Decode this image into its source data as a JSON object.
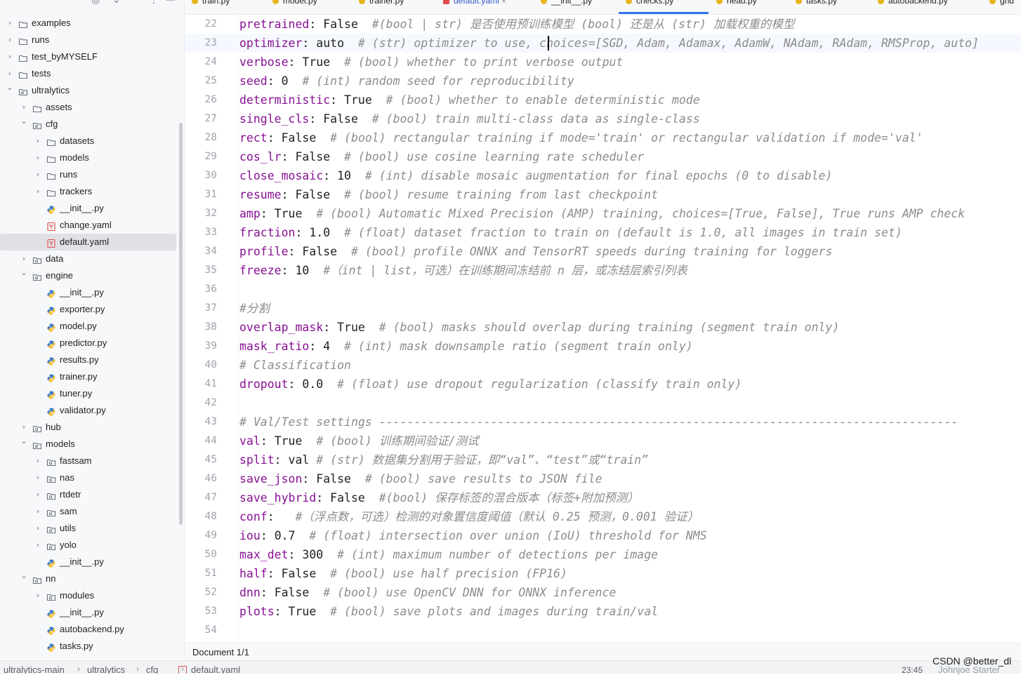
{
  "sidebar": {
    "items": [
      {
        "label": "examples",
        "type": "folder",
        "depth": 0,
        "open": false
      },
      {
        "label": "runs",
        "type": "folder",
        "depth": 0,
        "open": false
      },
      {
        "label": "test_byMYSELF",
        "type": "folder",
        "depth": 0,
        "open": false
      },
      {
        "label": "tests",
        "type": "folder",
        "depth": 0,
        "open": false
      },
      {
        "label": "ultralytics",
        "type": "package",
        "depth": 0,
        "open": true
      },
      {
        "label": "assets",
        "type": "folder",
        "depth": 1,
        "open": false
      },
      {
        "label": "cfg",
        "type": "package",
        "depth": 1,
        "open": true
      },
      {
        "label": "datasets",
        "type": "folder",
        "depth": 2,
        "open": false
      },
      {
        "label": "models",
        "type": "folder",
        "depth": 2,
        "open": false
      },
      {
        "label": "runs",
        "type": "folder",
        "depth": 2,
        "open": false
      },
      {
        "label": "trackers",
        "type": "folder",
        "depth": 2,
        "open": false
      },
      {
        "label": "__init__.py",
        "type": "python",
        "depth": 2
      },
      {
        "label": "change.yaml",
        "type": "yaml",
        "depth": 2
      },
      {
        "label": "default.yaml",
        "type": "yaml",
        "depth": 2,
        "selected": true
      },
      {
        "label": "data",
        "type": "package",
        "depth": 1,
        "open": false
      },
      {
        "label": "engine",
        "type": "package",
        "depth": 1,
        "open": true
      },
      {
        "label": "__init__.py",
        "type": "python",
        "depth": 2
      },
      {
        "label": "exporter.py",
        "type": "python",
        "depth": 2
      },
      {
        "label": "model.py",
        "type": "python",
        "depth": 2
      },
      {
        "label": "predictor.py",
        "type": "python",
        "depth": 2
      },
      {
        "label": "results.py",
        "type": "python",
        "depth": 2
      },
      {
        "label": "trainer.py",
        "type": "python",
        "depth": 2
      },
      {
        "label": "tuner.py",
        "type": "python",
        "depth": 2
      },
      {
        "label": "validator.py",
        "type": "python",
        "depth": 2
      },
      {
        "label": "hub",
        "type": "package",
        "depth": 1,
        "open": false
      },
      {
        "label": "models",
        "type": "package",
        "depth": 1,
        "open": true
      },
      {
        "label": "fastsam",
        "type": "package",
        "depth": 2,
        "open": false
      },
      {
        "label": "nas",
        "type": "package",
        "depth": 2,
        "open": false
      },
      {
        "label": "rtdetr",
        "type": "package",
        "depth": 2,
        "open": false
      },
      {
        "label": "sam",
        "type": "package",
        "depth": 2,
        "open": false
      },
      {
        "label": "utils",
        "type": "package",
        "depth": 2,
        "open": false
      },
      {
        "label": "yolo",
        "type": "package",
        "depth": 2,
        "open": false
      },
      {
        "label": "__init__.py",
        "type": "python",
        "depth": 2
      },
      {
        "label": "nn",
        "type": "package",
        "depth": 1,
        "open": true
      },
      {
        "label": "modules",
        "type": "package",
        "depth": 2,
        "open": false
      },
      {
        "label": "__init__.py",
        "type": "python",
        "depth": 2
      },
      {
        "label": "autobackend.py",
        "type": "python",
        "depth": 2
      },
      {
        "label": "tasks.py",
        "type": "python",
        "depth": 2
      }
    ]
  },
  "tabs": [
    {
      "label": "train.py"
    },
    {
      "label": "model.py"
    },
    {
      "label": "trainer.py"
    },
    {
      "label": "default.yaml",
      "active": true
    },
    {
      "label": "__init__.py"
    },
    {
      "label": "checks.py"
    },
    {
      "label": "head.py"
    },
    {
      "label": "tasks.py"
    },
    {
      "label": "autobackend.py"
    },
    {
      "label": "gnd"
    }
  ],
  "editor": {
    "lines": [
      {
        "n": "22",
        "key": "pretrained",
        "val": "False",
        "comment": "#(bool | str) 是否使用预训练模型 (bool) 还是从 (str) 加载权重的模型",
        "sep": "  "
      },
      {
        "n": "23",
        "key": "optimizer",
        "val": "auto",
        "comment": "# (str) optimizer to use, choices=[SGD, Adam, Adamax, AdamW, NAdam, RAdam, RMSProp, auto]",
        "sep": "  ",
        "current": true
      },
      {
        "n": "24",
        "key": "verbose",
        "val": "True",
        "comment": "# (bool) whether to print verbose output",
        "sep": "  "
      },
      {
        "n": "25",
        "key": "seed",
        "val": "0",
        "comment": "# (int) random seed for reproducibility",
        "sep": "  "
      },
      {
        "n": "26",
        "key": "deterministic",
        "val": "True",
        "comment": "# (bool) whether to enable deterministic mode",
        "sep": "  "
      },
      {
        "n": "27",
        "key": "single_cls",
        "val": "False",
        "comment": "# (bool) train multi-class data as single-class",
        "sep": "  "
      },
      {
        "n": "28",
        "key": "rect",
        "val": "False",
        "comment": "# (bool) rectangular training if mode='train' or rectangular validation if mode='val'",
        "sep": "  "
      },
      {
        "n": "29",
        "key": "cos_lr",
        "val": "False",
        "comment": "# (bool) use cosine learning rate scheduler",
        "sep": "  "
      },
      {
        "n": "30",
        "key": "close_mosaic",
        "val": "10",
        "comment": "# (int) disable mosaic augmentation for final epochs (0 to disable)",
        "sep": "  "
      },
      {
        "n": "31",
        "key": "resume",
        "val": "False",
        "comment": "# (bool) resume training from last checkpoint",
        "sep": "  "
      },
      {
        "n": "32",
        "key": "amp",
        "val": "True",
        "comment": "# (bool) Automatic Mixed Precision (AMP) training, choices=[True, False], True runs AMP check",
        "sep": "  "
      },
      {
        "n": "33",
        "key": "fraction",
        "val": "1.0",
        "comment": "# (float) dataset fraction to train on (default is 1.0, all images in train set)",
        "sep": "  "
      },
      {
        "n": "34",
        "key": "profile",
        "val": "False",
        "comment": "# (bool) profile ONNX and TensorRT speeds during training for loggers",
        "sep": "  "
      },
      {
        "n": "35",
        "key": "freeze",
        "val": "10",
        "comment": "#（int | list，可选）在训练期间冻结前 n 层，或冻结层索引列表",
        "sep": "  "
      },
      {
        "n": "36",
        "key": "",
        "val": "",
        "comment": "",
        "sep": ""
      },
      {
        "n": "37",
        "key": "",
        "val": "",
        "comment": "#分割",
        "sep": ""
      },
      {
        "n": "38",
        "key": "overlap_mask",
        "val": "True",
        "comment": "# (bool) masks should overlap during training (segment train only)",
        "sep": "  "
      },
      {
        "n": "39",
        "key": "mask_ratio",
        "val": "4",
        "comment": "# (int) mask downsample ratio (segment train only)",
        "sep": "  "
      },
      {
        "n": "40",
        "key": "",
        "val": "",
        "comment": "# Classification",
        "sep": ""
      },
      {
        "n": "41",
        "key": "dropout",
        "val": "0.0",
        "comment": "# (float) use dropout regularization (classify train only)",
        "sep": "  "
      },
      {
        "n": "42",
        "key": "",
        "val": "",
        "comment": "",
        "sep": ""
      },
      {
        "n": "43",
        "key": "",
        "val": "",
        "comment": "# Val/Test settings -----------------------------------------------------------------------------------",
        "sep": ""
      },
      {
        "n": "44",
        "key": "val",
        "val": "True",
        "comment": "# (bool) 训练期间验证/测试",
        "sep": "  "
      },
      {
        "n": "45",
        "key": "split",
        "val": "val",
        "comment": "# (str) 数据集分割用于验证，即“val”、“test”或“train”",
        "sep": " "
      },
      {
        "n": "46",
        "key": "save_json",
        "val": "False",
        "comment": "# (bool) save results to JSON file",
        "sep": "  "
      },
      {
        "n": "47",
        "key": "save_hybrid",
        "val": "False",
        "comment": "#(bool) 保存标签的混合版本（标签+附加预测）",
        "sep": "  "
      },
      {
        "n": "48",
        "key": "conf",
        "val": "",
        "comment": "#（浮点数，可选）检测的对象置信度阈值（默认 0.25 预测，0.001 验证）",
        "sep": "  "
      },
      {
        "n": "49",
        "key": "iou",
        "val": "0.7",
        "comment": "# (float) intersection over union (IoU) threshold for NMS",
        "sep": "  "
      },
      {
        "n": "50",
        "key": "max_det",
        "val": "300",
        "comment": "# (int) maximum number of detections per image",
        "sep": "  "
      },
      {
        "n": "51",
        "key": "half",
        "val": "False",
        "comment": "# (bool) use half precision (FP16)",
        "sep": "  "
      },
      {
        "n": "52",
        "key": "dnn",
        "val": "False",
        "comment": "# (bool) use OpenCV DNN for ONNX inference",
        "sep": "  "
      },
      {
        "n": "53",
        "key": "plots",
        "val": "True",
        "comment": "# (bool) save plots and images during train/val",
        "sep": "  "
      },
      {
        "n": "54",
        "key": "",
        "val": "",
        "comment": "",
        "sep": ""
      }
    ]
  },
  "doc_bar": {
    "label": "Document 1/1"
  },
  "status": {
    "crumbs": [
      "ultralytics-main",
      "ultralytics",
      "cfg",
      "default.yaml"
    ],
    "time": "23:45",
    "watermark": "CSDN @better_dl",
    "watermark2": "Johnjoe Starter"
  },
  "colors": {
    "accent": "#3574f0",
    "key": "#871094",
    "comment": "#8c8c8c",
    "python": "#e8b41c",
    "yaml": "#e24d4d"
  },
  "icons": [
    "folder-icon",
    "package-icon",
    "python-file-icon",
    "yaml-file-icon",
    "chevron-right-icon",
    "chevron-down-icon"
  ]
}
